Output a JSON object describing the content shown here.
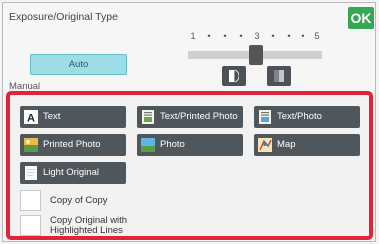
{
  "title": "Exposure/Original Type",
  "ok_label": "OK",
  "auto_label": "Auto",
  "manual_label": "Manual",
  "exposure": {
    "scale": [
      "1",
      "•",
      "•",
      "•",
      "3",
      "•",
      "•",
      "•",
      "5"
    ],
    "current_level": 3
  },
  "original_types": [
    {
      "label": "Text",
      "icon": "text-icon"
    },
    {
      "label": "Text/Printed Photo",
      "icon": "text-printed-photo-icon"
    },
    {
      "label": "Text/Photo",
      "icon": "text-photo-icon"
    },
    {
      "label": "Printed Photo",
      "icon": "printed-photo-icon"
    },
    {
      "label": "Photo",
      "icon": "photo-icon"
    },
    {
      "label": "Map",
      "icon": "map-icon"
    },
    {
      "label": "Light Original",
      "icon": "light-original-icon"
    }
  ],
  "checkboxes": [
    {
      "label": "Copy of Copy",
      "checked": false
    },
    {
      "label": "Copy Original with Highlighted Lines",
      "checked": false
    }
  ],
  "colors": {
    "ok": "#35a853",
    "highlight_border": "#e0243a",
    "auto_button": "#9ddde8",
    "type_button": "#4f565c"
  }
}
